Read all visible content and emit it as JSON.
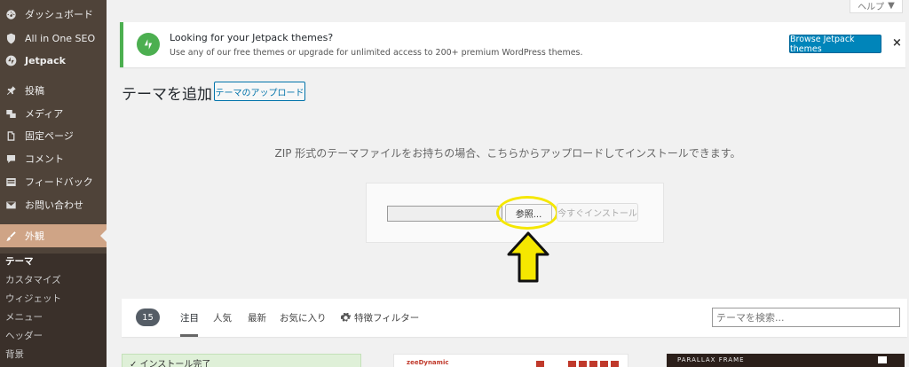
{
  "sidebar": {
    "items": [
      {
        "label": "ダッシュボード",
        "icon": "dashboard-icon"
      },
      {
        "label": "All in One SEO",
        "icon": "shield-icon"
      },
      {
        "label": "Jetpack",
        "icon": "jetpack-icon"
      },
      {
        "label": "投稿",
        "icon": "pin-icon"
      },
      {
        "label": "メディア",
        "icon": "media-icon"
      },
      {
        "label": "固定ページ",
        "icon": "page-icon"
      },
      {
        "label": "コメント",
        "icon": "comment-icon"
      },
      {
        "label": "フィードバック",
        "icon": "feedback-icon"
      },
      {
        "label": "お問い合わせ",
        "icon": "mail-icon"
      },
      {
        "label": "外観",
        "icon": "brush-icon",
        "active": true
      }
    ],
    "submenu": [
      "テーマ",
      "カスタマイズ",
      "ウィジェット",
      "メニュー",
      "ヘッダー",
      "背景"
    ]
  },
  "help_tab": {
    "label": "ヘルプ",
    "icon": "triangle-down-icon"
  },
  "notice": {
    "title": "Looking for your Jetpack themes?",
    "description": "Use any of our free themes or upgrade for unlimited access to 200+ premium WordPress themes.",
    "button": "Browse Jetpack themes",
    "close": "×"
  },
  "header": {
    "title": "テーマを追加",
    "upload_button": "テーマのアップロード"
  },
  "upload": {
    "description": "ZIP 形式のテーマファイルをお持ちの場合、こちらからアップロードしてインストールできます。",
    "browse_button": "参照...",
    "install_button": "今すぐインストール"
  },
  "filter_bar": {
    "count": "15",
    "tabs": [
      "注目",
      "人気",
      "最新",
      "お気に入り"
    ],
    "current_tab": "注目",
    "feature_filter": "特徴フィルター",
    "search_placeholder": "テーマを検索..."
  },
  "cards": {
    "installed_label": "インストール完了",
    "card2_logo": "zeeDynamic",
    "card3_title": "PARALLAX FRAME"
  },
  "colors": {
    "sidebar_bg": "#4f4339",
    "active_menu": "#cfa486",
    "jetpack_green": "#4caf50",
    "primary_blue": "#0085ba",
    "highlight_yellow": "#f5e700"
  }
}
